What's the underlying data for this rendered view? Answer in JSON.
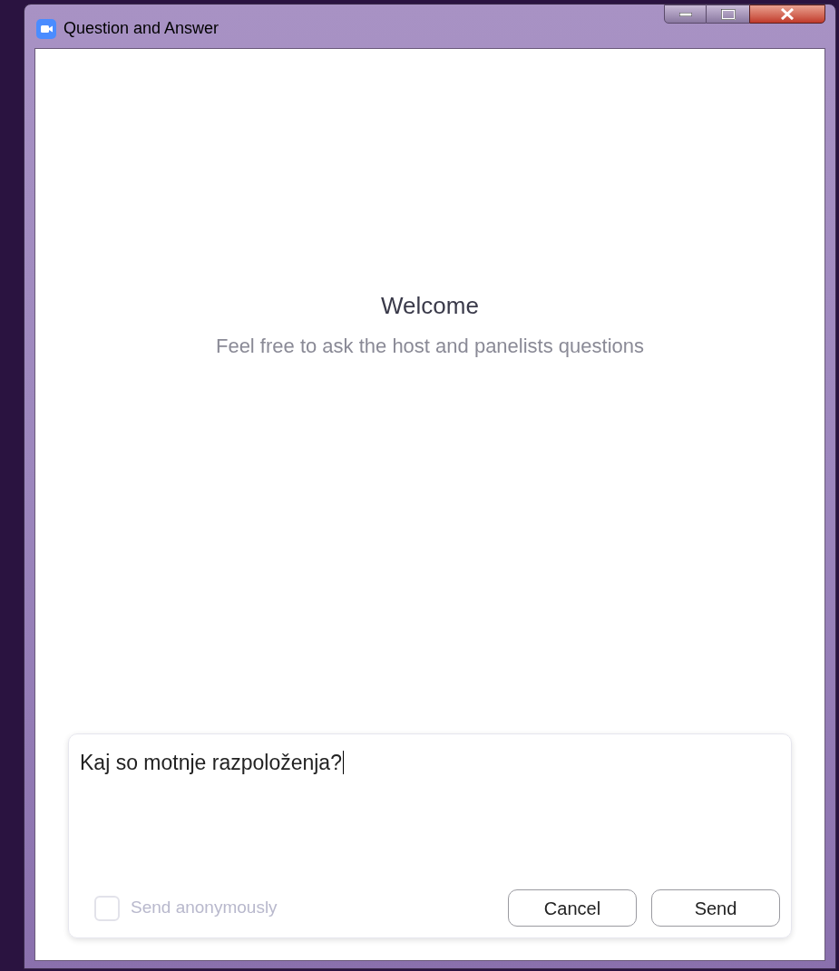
{
  "window": {
    "title": "Question and Answer"
  },
  "welcome": {
    "title": "Welcome",
    "subtitle": "Feel free to ask the host and panelists questions"
  },
  "question_box": {
    "value": "Kaj so motnje razpoloženja?",
    "anonymous": {
      "label": "Send anonymously",
      "checked": false,
      "disabled": true
    },
    "buttons": [
      "Cancel",
      "Send"
    ]
  }
}
